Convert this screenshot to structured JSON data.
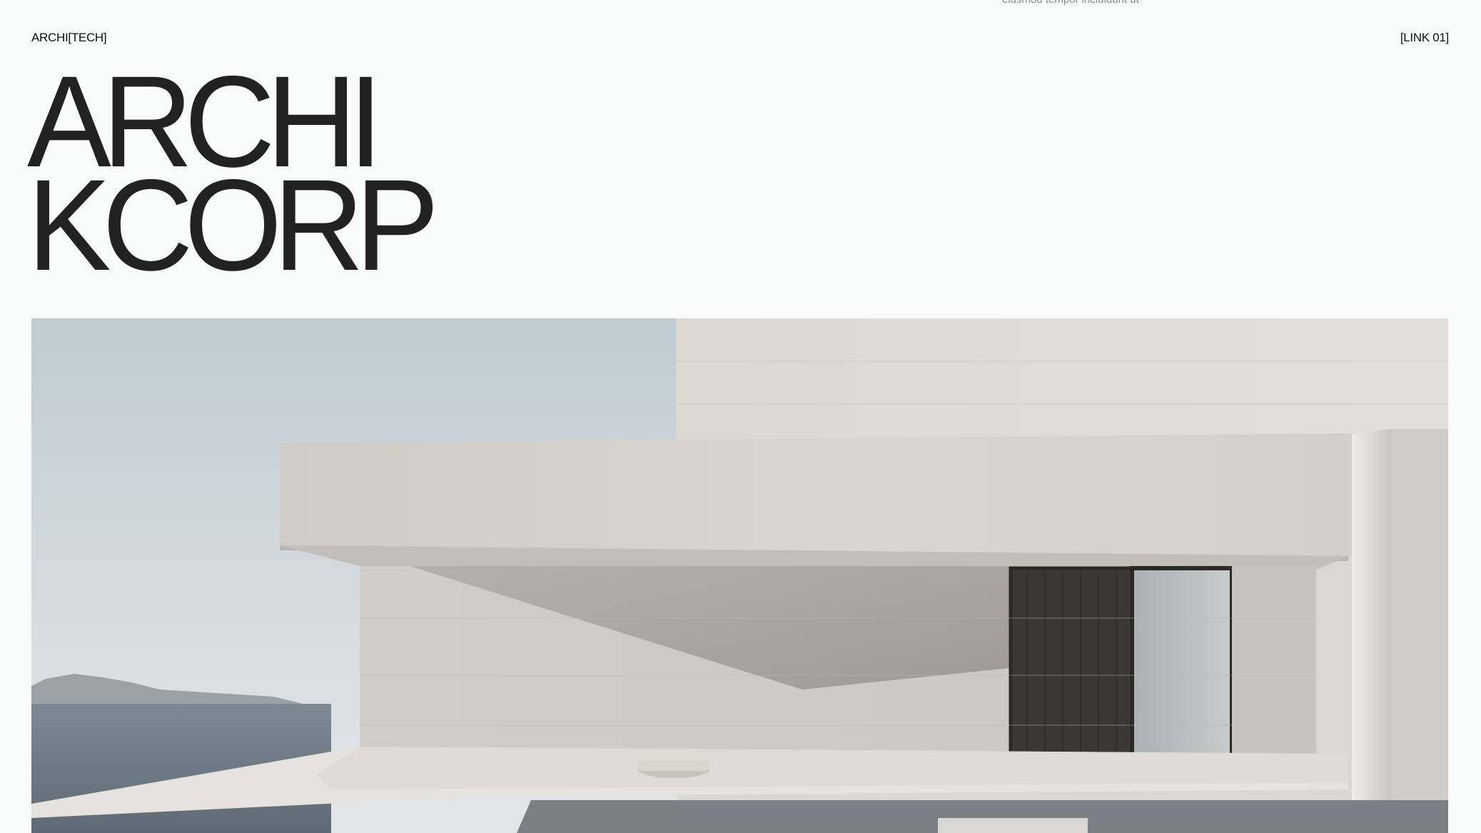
{
  "header": {
    "top_fragment": "eiusmod tempor incididunt ut",
    "brand": "ARCHI[TECH]",
    "nav_link": "[LINK 01]"
  },
  "hero": {
    "title_line_1": "ARCHI",
    "title_line_2": "KCORP",
    "image_icon": "modern-concrete-house-photo"
  },
  "colors": {
    "background": "#f9fafa",
    "text": "#1e1e1e",
    "muted_text": "#8a8a8a",
    "sky": "#c6d0d6",
    "concrete": "#d5d2cd"
  }
}
